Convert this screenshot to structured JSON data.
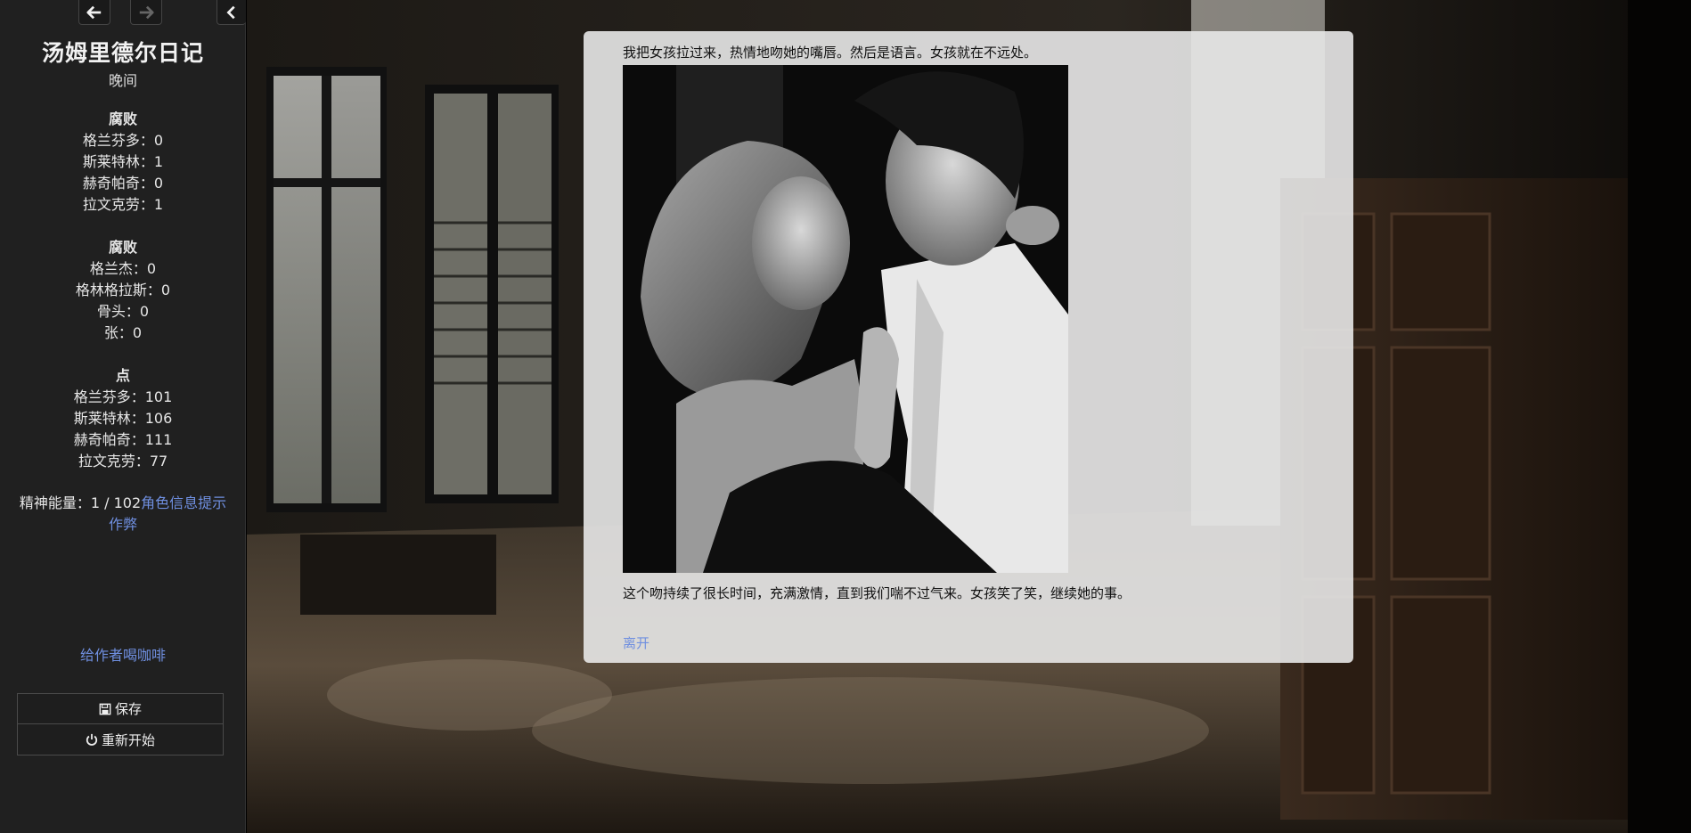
{
  "sidebar": {
    "title": "汤姆里德尔日记",
    "time_of_day": "晚间",
    "blocks": [
      {
        "heading": "腐败",
        "lines": [
          "格兰芬多：0",
          "斯莱特林：1",
          "赫奇帕奇：0",
          "拉文克劳：1"
        ]
      },
      {
        "heading": "腐败",
        "lines": [
          "格兰杰：0",
          "格林格拉斯：0",
          "骨头：0",
          "张：0"
        ]
      },
      {
        "heading": "点",
        "lines": [
          "格兰芬多：101",
          "斯莱特林：106",
          "赫奇帕奇：111",
          "拉文克劳：77"
        ]
      }
    ],
    "energy_label": "精神能量：1 / 102",
    "character_info_link": "角色信息提示",
    "cheat_link": "作弊",
    "coffee_link": "给作者喝咖啡",
    "save_label": "保存",
    "restart_label": "重新开始"
  },
  "passage": {
    "text_before": "我把女孩拉过来，热情地吻她的嘴唇。然后是语言。女孩就在不远处。",
    "text_after": "这个吻持续了很长时间，充满激情，直到我们喘不过气来。女孩笑了笑，继续她的事。",
    "leave_link": "离开"
  },
  "colors": {
    "sidebar_bg": "#202020",
    "link": "#6f8fe0",
    "panel_bg": "rgba(232,232,232,0.90)"
  },
  "icons": [
    "arrow-left-icon",
    "arrow-right-icon",
    "chevron-left-icon",
    "floppy-disk-icon",
    "power-icon"
  ]
}
